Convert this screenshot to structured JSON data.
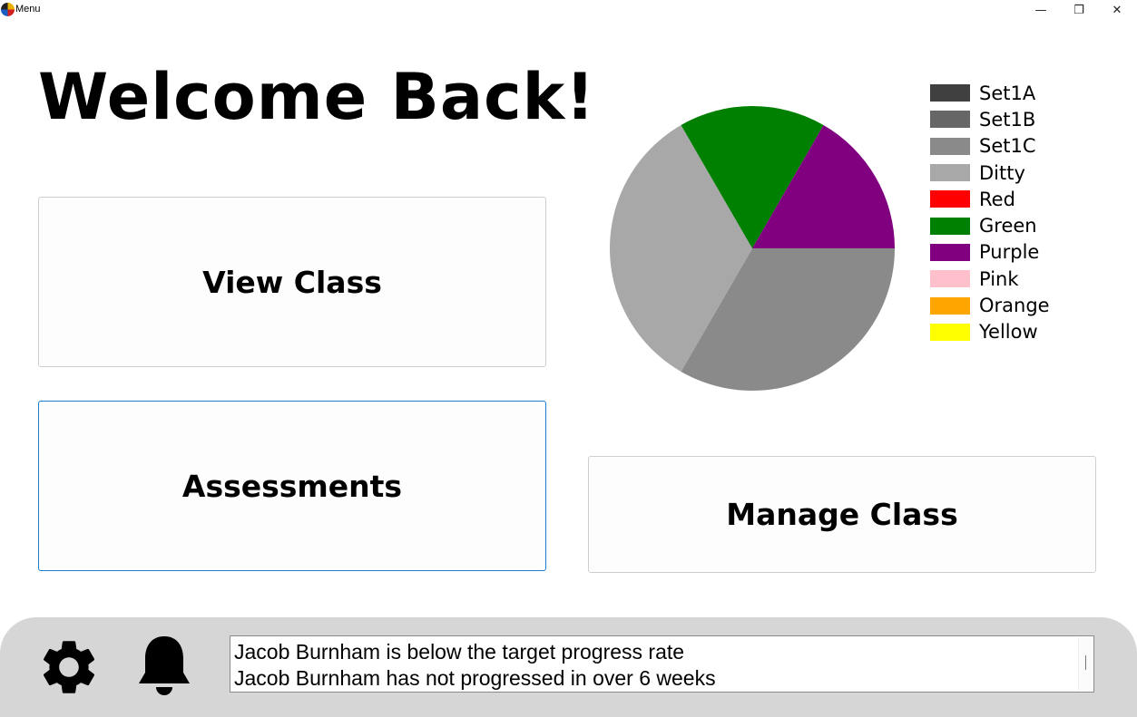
{
  "window": {
    "title": "Menu",
    "minimize": "—",
    "maximize": "❐",
    "close": "✕"
  },
  "heading": "Welcome Back!",
  "buttons": {
    "view_class": "View Class",
    "assessments": "Assessments",
    "manage_class": "Manage Class"
  },
  "chart_data": {
    "type": "pie",
    "categories": [
      "Set1A",
      "Set1B",
      "Set1C",
      "Ditty",
      "Red",
      "Green",
      "Purple",
      "Pink",
      "Orange",
      "Yellow"
    ],
    "values": [
      0,
      0,
      2,
      2,
      0,
      1,
      1,
      0,
      0,
      0
    ],
    "colors": [
      "#404040",
      "#666666",
      "#8a8a8a",
      "#a8a8a8",
      "#ff0000",
      "#008000",
      "#800080",
      "#ffc0cb",
      "#ffa500",
      "#ffff00"
    ],
    "legend": "right"
  },
  "notifications": [
    "Jacob Burnham is below the target progress rate",
    "Jacob Burnham has not progressed in over 6 weeks"
  ],
  "footer": {
    "settings_icon": "gear-icon",
    "notifications_icon": "bell-icon"
  }
}
